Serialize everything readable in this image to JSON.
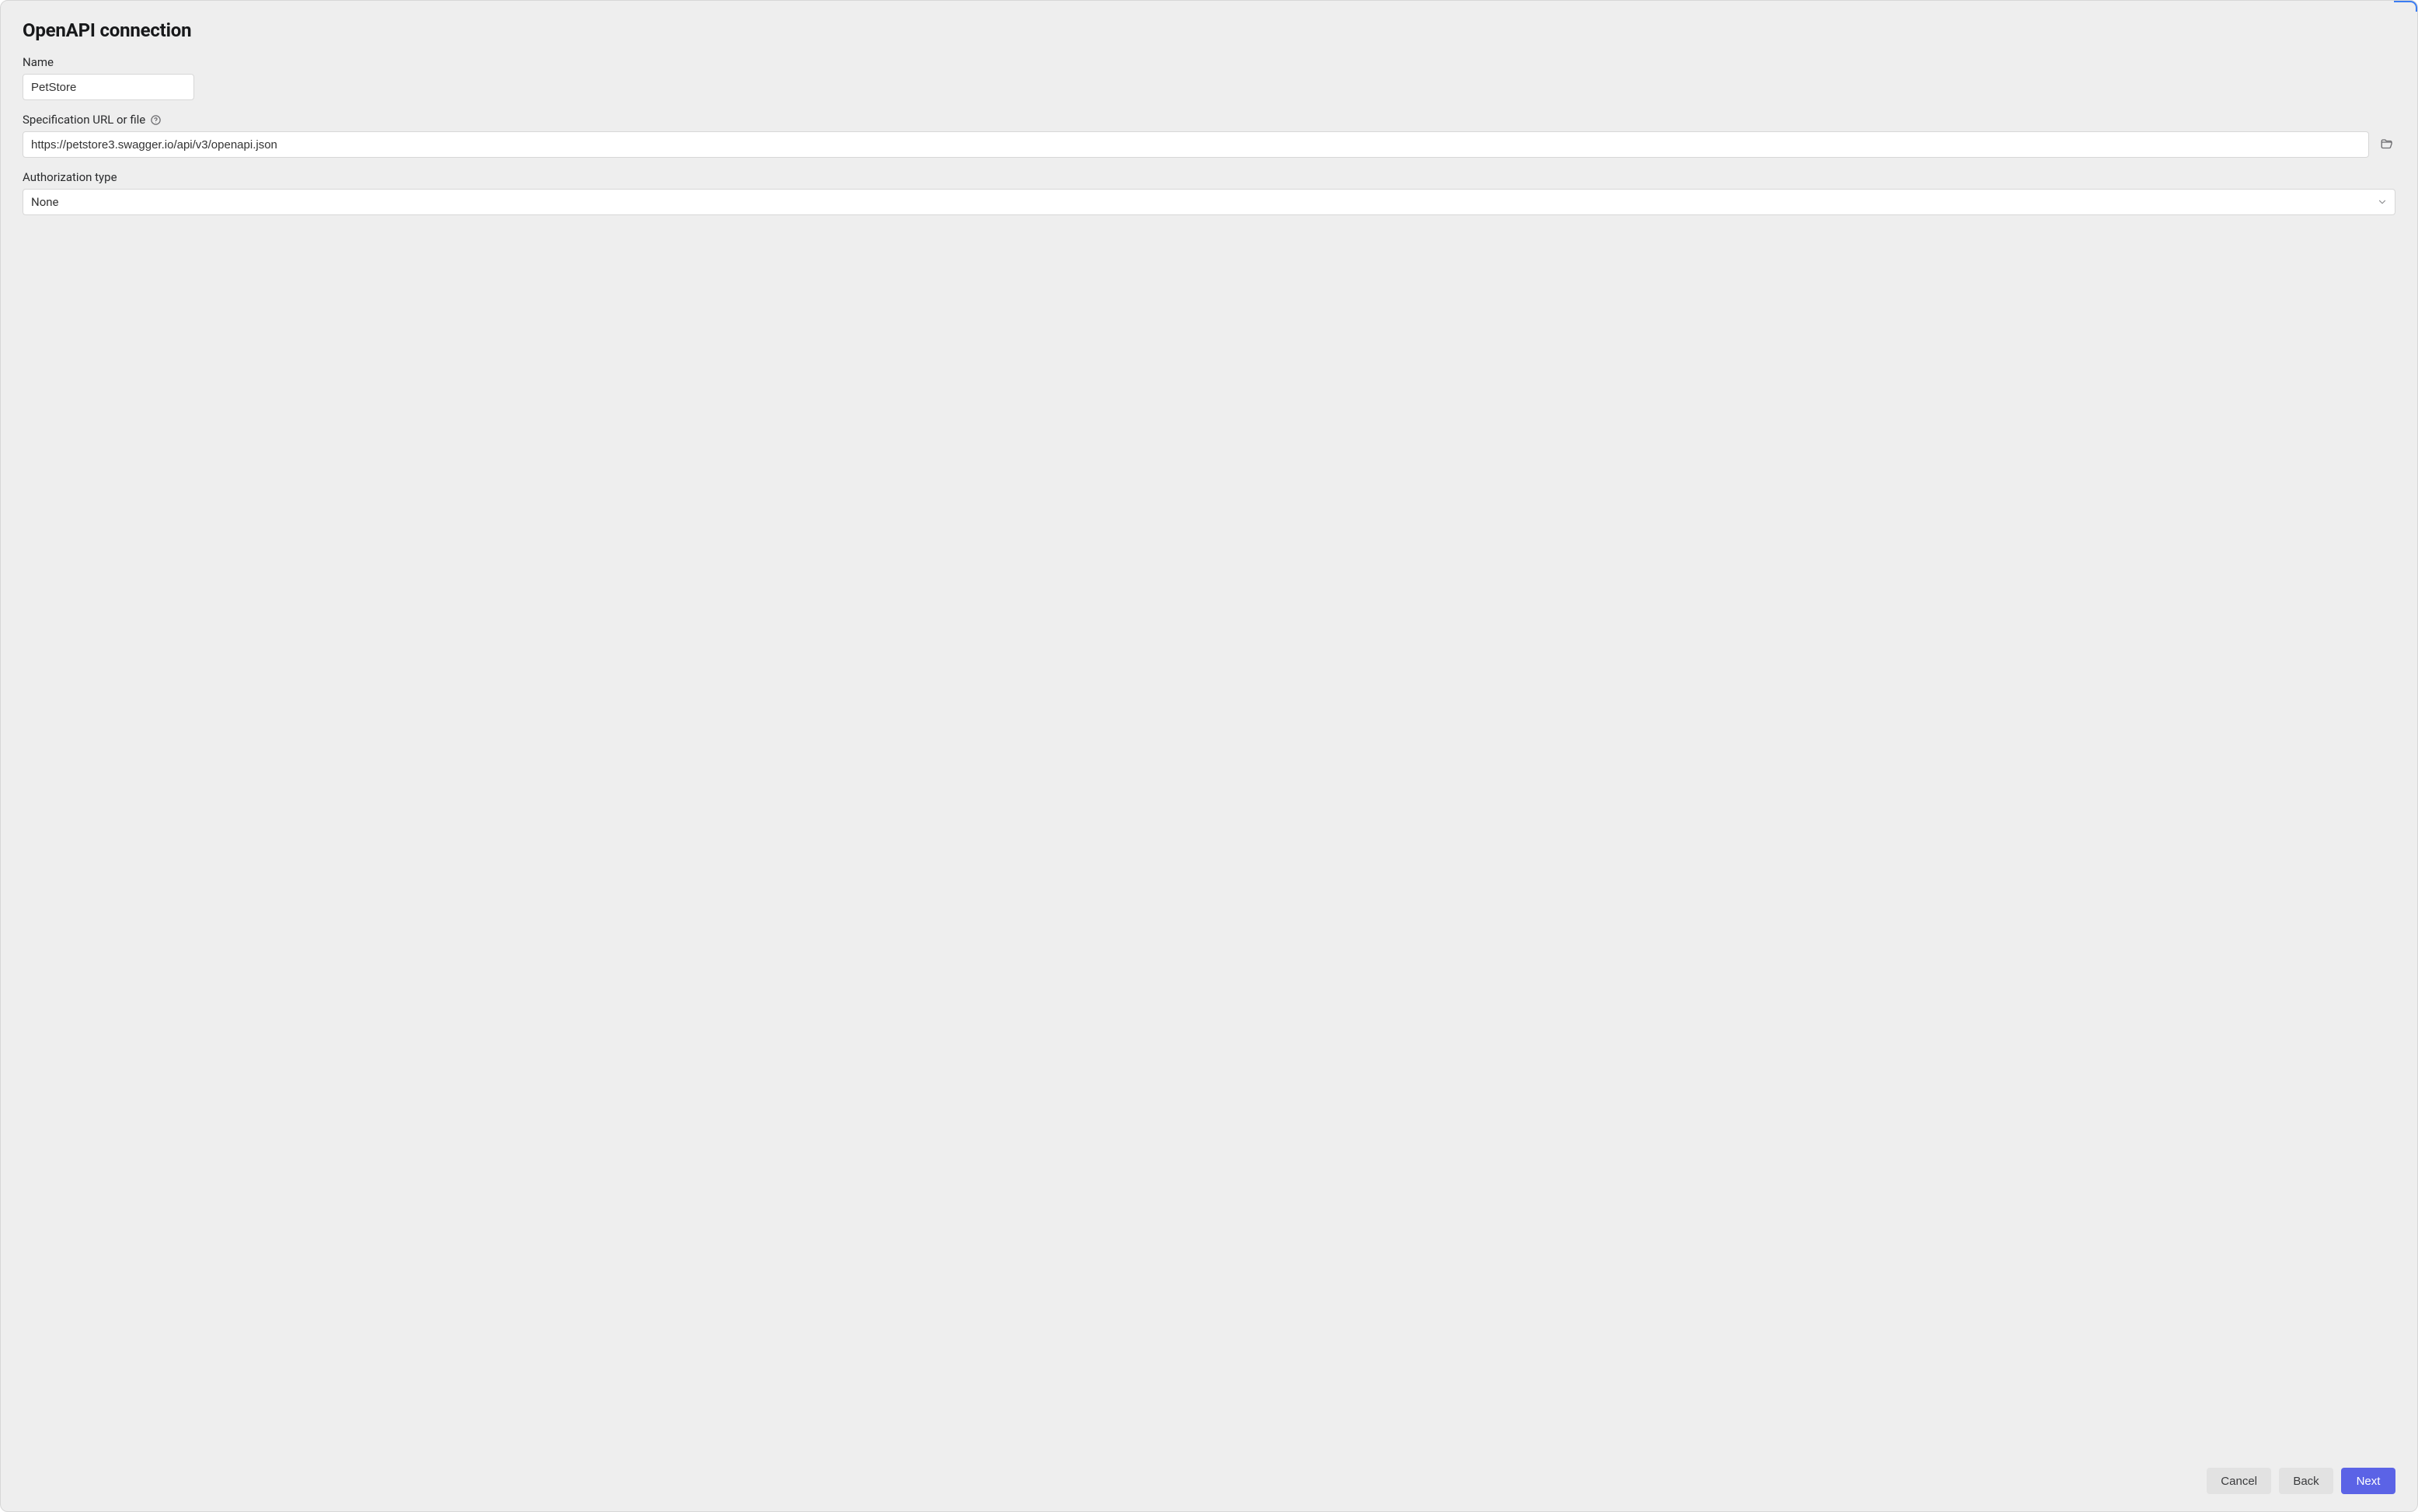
{
  "title": "OpenAPI connection",
  "fields": {
    "name": {
      "label": "Name",
      "value": "PetStore"
    },
    "spec": {
      "label": "Specification URL or file",
      "value": "https://petstore3.swagger.io/api/v3/openapi.json"
    },
    "auth": {
      "label": "Authorization type",
      "selected": "None"
    }
  },
  "buttons": {
    "cancel": "Cancel",
    "back": "Back",
    "next": "Next"
  }
}
